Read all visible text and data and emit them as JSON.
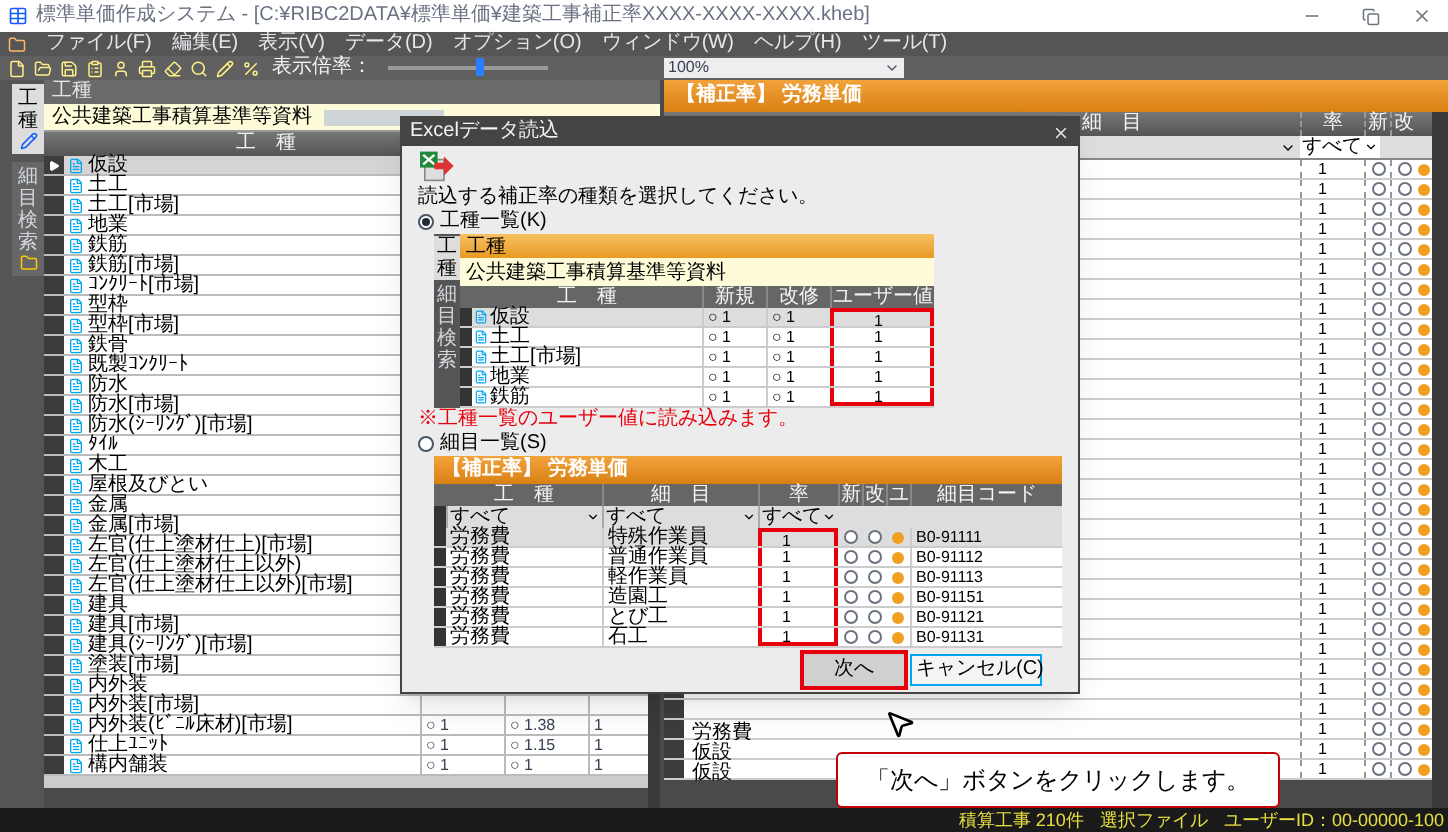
{
  "window": {
    "title": "標準単価作成システム - [C:¥RIBC2DATA¥標準単価¥建築工事補正率XXXX-XXXX-XXXX.kheb]"
  },
  "menu": [
    "ファイル(F)",
    "編集(E)",
    "表示(V)",
    "データ(D)",
    "オプション(O)",
    "ウィンドウ(W)",
    "ヘルプ(H)",
    "ツール(T)"
  ],
  "toolbar": {
    "zoom_label": "表示倍率：",
    "level": 0.55,
    "zoom_value": "100%"
  },
  "side_tabs": [
    {
      "label": "工種",
      "selected": true
    },
    {
      "label": "細目検索",
      "selected": false
    }
  ],
  "work_panel": {
    "title": "工種",
    "source": "公共建築工事積算基準等資料",
    "column": "工　種",
    "rows": [
      {
        "name": "仮設",
        "selected": true
      },
      {
        "name": "土工",
        "selected": false
      },
      {
        "name": "土工[市場]",
        "selected": false
      },
      {
        "name": "地業",
        "selected": false
      },
      {
        "name": "鉄筋",
        "selected": false
      },
      {
        "name": "鉄筋[市場]",
        "selected": false
      },
      {
        "name": "ｺﾝｸﾘｰﾄ[市場]",
        "selected": false
      },
      {
        "name": "型枠",
        "selected": false
      },
      {
        "name": "型枠[市場]",
        "selected": false
      },
      {
        "name": "鉄骨",
        "selected": false
      },
      {
        "name": "既製ｺﾝｸﾘｰﾄ",
        "selected": false
      },
      {
        "name": "防水",
        "selected": false
      },
      {
        "name": "防水[市場]",
        "selected": false
      },
      {
        "name": "防水(ｼｰﾘﾝｸﾞ)[市場]",
        "selected": false
      },
      {
        "name": "ﾀｲﾙ",
        "selected": false
      },
      {
        "name": "木工",
        "selected": false
      },
      {
        "name": "屋根及びとい",
        "selected": false
      },
      {
        "name": "金属",
        "selected": false
      },
      {
        "name": "金属[市場]",
        "selected": false
      },
      {
        "name": "左官(仕上塗材仕上)[市場]",
        "selected": false
      },
      {
        "name": "左官(仕上塗材仕上以外)",
        "selected": false
      },
      {
        "name": "左官(仕上塗材仕上以外)[市場]",
        "selected": false
      },
      {
        "name": "建具",
        "selected": false
      },
      {
        "name": "建具[市場]",
        "selected": false
      },
      {
        "name": "建具(ｼｰﾘﾝｸﾞ)[市場]",
        "selected": false
      },
      {
        "name": "塗装[市場]",
        "selected": false
      },
      {
        "name": "内外装",
        "selected": false
      },
      {
        "name": "内外装[市場]",
        "selected": false
      },
      {
        "name": "内外装(ﾋﾞﾆﾙ床材)[市場]",
        "selected": false,
        "values": [
          "○ 1",
          "○ 1.38",
          "1"
        ]
      },
      {
        "name": "仕上ﾕﾆｯﾄ",
        "selected": false,
        "values": [
          "○ 1",
          "○ 1.15",
          "1"
        ]
      },
      {
        "name": "構内舗装",
        "selected": false,
        "values": [
          "○ 1",
          "○ 1",
          "1"
        ]
      }
    ]
  },
  "rate_panel": {
    "title": "【補正率】 労務単価",
    "columns": [
      "細　目",
      "率",
      "新",
      "改"
    ],
    "filter": "すべて",
    "rows": [
      {
        "rate": "1"
      },
      {
        "rate": "1"
      },
      {
        "rate": "1"
      },
      {
        "rate": "1"
      },
      {
        "rate": "1"
      },
      {
        "rate": "1"
      },
      {
        "rate": "1"
      },
      {
        "rate": "1"
      },
      {
        "rate": "1"
      },
      {
        "rate": "1"
      },
      {
        "rate": "1"
      },
      {
        "rate": "1"
      },
      {
        "rate": "1"
      },
      {
        "rate": "1"
      },
      {
        "rate": "1"
      },
      {
        "rate": "1"
      },
      {
        "rate": "1"
      },
      {
        "rate": "1"
      },
      {
        "rate": "1"
      },
      {
        "rate": "1"
      },
      {
        "rate": "1"
      },
      {
        "rate": "1"
      },
      {
        "rate": "1"
      },
      {
        "rate": "1"
      },
      {
        "rate": "1"
      },
      {
        "rate": "1"
      },
      {
        "rate": "1"
      },
      {
        "rate": "1"
      },
      {
        "rate": "1",
        "work": "労務費"
      },
      {
        "rate": "1",
        "work": "仮設"
      },
      {
        "rate": "1",
        "work": "仮設"
      }
    ]
  },
  "dialog": {
    "title": "Excelデータ読込",
    "prompt": "読込する補正率の種類を選択してください。",
    "options": [
      {
        "label": "工種一覧(K)",
        "selected": true
      },
      {
        "label": "細目一覧(S)",
        "selected": false
      }
    ],
    "work_preview": {
      "tabs": [
        {
          "label": "工種",
          "selected": true
        },
        {
          "label": "細目検索",
          "selected": false
        }
      ],
      "title": "工種",
      "source": "公共建築工事積算基準等資料",
      "columns": [
        "工　種",
        "新規",
        "改修",
        "ユーザー値"
      ],
      "rows": [
        {
          "name": "仮設",
          "new": "○ 1",
          "mod": "○ 1",
          "user": "1",
          "selected": true
        },
        {
          "name": "土工",
          "new": "○ 1",
          "mod": "○ 1",
          "user": "1",
          "selected": false
        },
        {
          "name": "土工[市場]",
          "new": "○ 1",
          "mod": "○ 1",
          "user": "1",
          "selected": false
        },
        {
          "name": "地業",
          "new": "○ 1",
          "mod": "○ 1",
          "user": "1",
          "selected": false
        },
        {
          "name": "鉄筋",
          "new": "○ 1",
          "mod": "○ 1",
          "user": "1",
          "selected": false
        }
      ]
    },
    "note": "※工種一覧のユーザー値に読み込みます。",
    "detail_preview": {
      "title": "【補正率】 労務単価",
      "columns": [
        "工　種",
        "細　目",
        "率",
        "新",
        "改",
        "ユ",
        "細目コード"
      ],
      "filters": [
        "すべて",
        "すべて",
        "すべて"
      ],
      "rows": [
        {
          "work": "労務費",
          "detail": "特殊作業員",
          "rate": "1",
          "code": "B0-91111",
          "selected": true
        },
        {
          "work": "労務費",
          "detail": "普通作業員",
          "rate": "1",
          "code": "B0-91112",
          "selected": false
        },
        {
          "work": "労務費",
          "detail": "軽作業員",
          "rate": "1",
          "code": "B0-91113",
          "selected": false
        },
        {
          "work": "労務費",
          "detail": "造園工",
          "rate": "1",
          "code": "B0-91151",
          "selected": false
        },
        {
          "work": "労務費",
          "detail": "とび工",
          "rate": "1",
          "code": "B0-91121",
          "selected": false
        },
        {
          "work": "労務費",
          "detail": "石工",
          "rate": "1",
          "code": "B0-91131",
          "selected": false
        }
      ]
    },
    "buttons": [
      {
        "label": "次へ",
        "kind": "primary"
      },
      {
        "label": "キャンセル(C)",
        "kind": "cancel"
      }
    ]
  },
  "callout": "「次へ」ボタンをクリックします。",
  "status_bar": [
    "積算工事 210件",
    "選択ファイル",
    "ユーザーID：00-00000-100"
  ]
}
